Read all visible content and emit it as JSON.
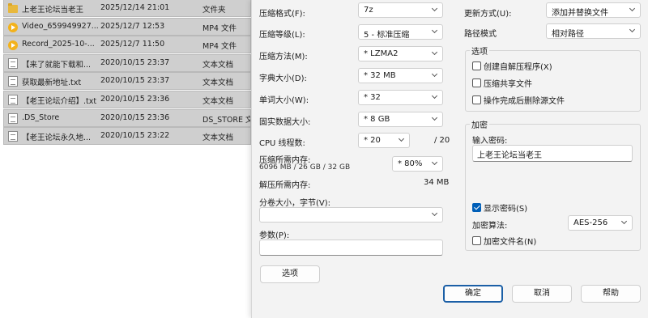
{
  "files": [
    {
      "icon": "folder-icon",
      "name": "上老王论坛当老王",
      "date": "2025/12/14 21:01",
      "type": "文件夹"
    },
    {
      "icon": "video-file-icon",
      "name": "Video_659949927...",
      "date": "2025/12/7 12:53",
      "type": "MP4 文件"
    },
    {
      "icon": "video-file-icon",
      "name": "Record_2025-10-...",
      "date": "2025/12/7 11:50",
      "type": "MP4 文件"
    },
    {
      "icon": "text-file-icon",
      "name": "【来了就能下载和...",
      "date": "2020/10/15 23:37",
      "type": "文本文档"
    },
    {
      "icon": "text-file-icon",
      "name": "获取最新地址.txt",
      "date": "2020/10/15 23:37",
      "type": "文本文档"
    },
    {
      "icon": "text-file-icon",
      "name": "【老王论坛介绍】.txt",
      "date": "2020/10/15 23:36",
      "type": "文本文档"
    },
    {
      "icon": "text-file-icon",
      "name": ".DS_Store",
      "date": "2020/10/15 23:36",
      "type": "DS_STORE 文"
    },
    {
      "icon": "text-file-icon",
      "name": "【老王论坛永久地...",
      "date": "2020/10/15 23:22",
      "type": "文本文档"
    }
  ],
  "dialog": {
    "archive_format": {
      "label": "压缩格式(F):",
      "value": "7z"
    },
    "compression_level": {
      "label": "压缩等级(L):",
      "value": "5 - 标准压缩"
    },
    "compression_method": {
      "label": "压缩方法(M):",
      "value": "* LZMA2"
    },
    "dictionary_size": {
      "label": "字典大小(D):",
      "value": "* 32 MB"
    },
    "word_size": {
      "label": "单词大小(W):",
      "value": "* 32"
    },
    "solid_block_size": {
      "label": "固实数据大小:",
      "value": "* 8 GB"
    },
    "cpu_threads": {
      "label": "CPU 线程数:",
      "value": "* 20",
      "max": "/ 20"
    },
    "memory_compress": {
      "label": "压缩所需内存:",
      "detail": "6096 MB / 26 GB / 32 GB",
      "value": "* 80%"
    },
    "memory_decompress": {
      "label": "解压所需内存:",
      "value": "34 MB"
    },
    "split_volume": {
      "label": "分卷大小，字节(V):",
      "value": ""
    },
    "parameters": {
      "label": "参数(P):",
      "value": ""
    },
    "options_button": "选项",
    "update_mode": {
      "label": "更新方式(U):",
      "value": "添加并替换文件"
    },
    "path_mode": {
      "label": "路径模式",
      "value": "相对路径"
    },
    "options_group": {
      "title": "选项",
      "sfx": {
        "label": "创建自解压程序(X)",
        "checked": false
      },
      "shared": {
        "label": "压缩共享文件",
        "checked": false
      },
      "delete_after": {
        "label": "操作完成后删除源文件",
        "checked": false
      }
    },
    "encryption_group": {
      "title": "加密",
      "password_label": "输入密码:",
      "password_value": "上老王论坛当老王",
      "show_password": {
        "label": "显示密码(S)",
        "checked": true
      },
      "method_label": "加密算法:",
      "method_value": "AES-256",
      "encrypt_names": {
        "label": "加密文件名(N)",
        "checked": false
      }
    },
    "buttons": {
      "ok": "确定",
      "cancel": "取消",
      "help": "帮助"
    }
  },
  "colors": {
    "accent": "#005fb8",
    "dialog_bg": "#f3f3f3",
    "row_selected": "#cfcfcf"
  }
}
